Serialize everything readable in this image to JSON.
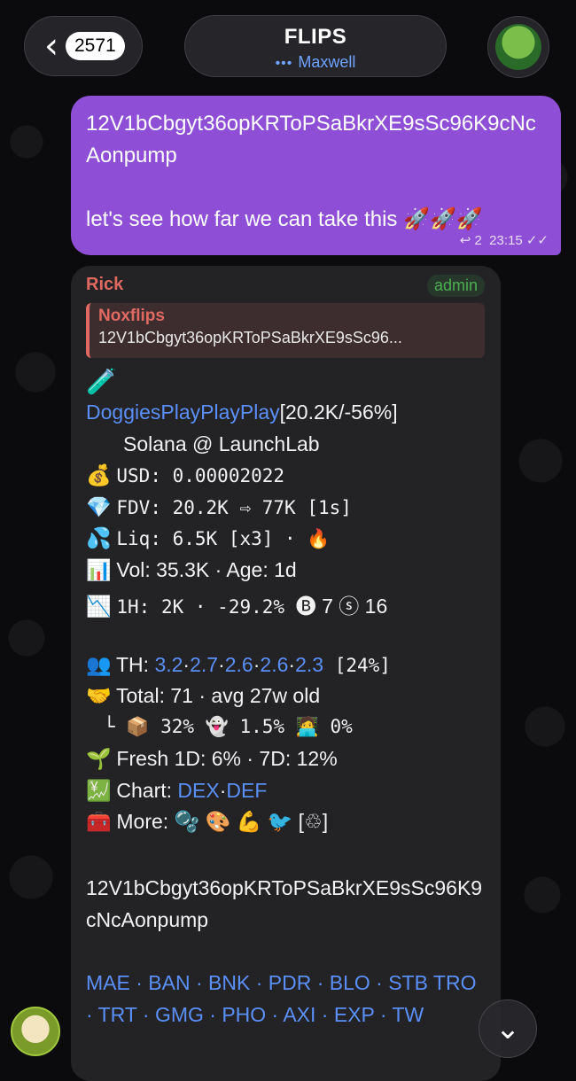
{
  "header": {
    "back_count": "2571",
    "title": "FLIPS",
    "status": "Maxwell"
  },
  "outgoing": {
    "text": "12V1bCbgyt36opKRToPSaBkrXE9sSc96K9cNcAonpump\n\nlet's see how far we can take this 🚀🚀🚀",
    "replies": "2",
    "time": "23:15"
  },
  "incoming": {
    "sender": "Rick",
    "role": "admin",
    "reply_name": "Noxflips",
    "reply_text": "12V1bCbgyt36opKRToPSaBkrXE9sSc96...",
    "token_name": "DoggiesPlayPlayPlay",
    "token_stats": "[20.2K/-56%]",
    "chain": "Solana @ LaunchLab",
    "usd": "USD: 0.00002022",
    "fdv": "FDV: 20.2K ⇨ 77K [1s]",
    "liq": "Liq: 6.5K [x3] · 🔥",
    "vol": "Vol: 35.3K · Age: 1d",
    "h1_a": "1H: 2K · -29.2% ",
    "h1_b": "🅑 7 ⓢ 16",
    "th_label": "TH: ",
    "th_values": [
      "3.2",
      "2.7",
      "2.6",
      "2.6",
      "2.3"
    ],
    "th_pct": " [24%]",
    "total": "Total: 71 · avg 27w old",
    "holders": "└ 📦 32% 👻 1.5% 🧑‍💻 0%",
    "fresh": "Fresh 1D: 6% · 7D: 12%",
    "chart_label": "Chart: ",
    "chart_links": [
      "DEX",
      "DEF"
    ],
    "more": "More: 🫧 🎨 💪 🐦 [♲]",
    "address": "12V1bCbgyt36opKRToPSaBkrXE9sSc96K9cNcAonpump",
    "tags": "MAE · BAN · BNK · PDR · BLO · STB TRO · TRT · GMG · PHO · AXI · EXP · TW"
  }
}
